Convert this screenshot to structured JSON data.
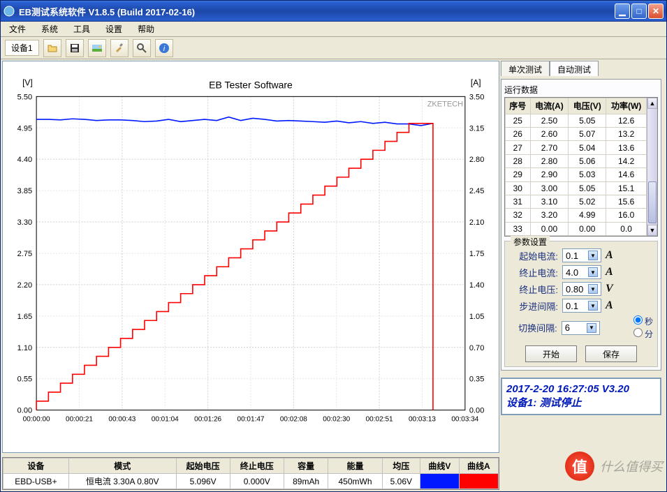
{
  "window": {
    "title": "EB测试系统软件  V1.8.5 (Build 2017-02-16)"
  },
  "menus": [
    "文件",
    "系统",
    "工具",
    "设置",
    "帮助"
  ],
  "toolbar": {
    "device_label": "设备1"
  },
  "chart_data": {
    "type": "line",
    "title": "EB Tester Software",
    "left_unit": "[V]",
    "right_unit": "[A]",
    "watermark": "ZKETECH",
    "x_ticks": [
      "00:00:00",
      "00:00:21",
      "00:00:43",
      "00:01:04",
      "00:01:26",
      "00:01:47",
      "00:02:08",
      "00:02:30",
      "00:02:51",
      "00:03:13",
      "00:03:34"
    ],
    "v_ticks": [
      "5.50",
      "4.95",
      "4.40",
      "3.85",
      "3.30",
      "2.75",
      "2.20",
      "1.65",
      "1.10",
      "0.55",
      "0.00"
    ],
    "a_ticks": [
      "3.50",
      "3.15",
      "2.80",
      "2.45",
      "2.10",
      "1.75",
      "1.40",
      "1.05",
      "0.70",
      "0.35",
      "0.00"
    ],
    "v_range": [
      0,
      5.5
    ],
    "a_range": [
      0,
      3.5
    ],
    "x_range_sec": [
      0,
      214
    ],
    "series": [
      {
        "name": "曲线V",
        "axis": "V",
        "color": "#0018ff",
        "points": [
          [
            0,
            5.1
          ],
          [
            6,
            5.1
          ],
          [
            12,
            5.09
          ],
          [
            18,
            5.11
          ],
          [
            24,
            5.1
          ],
          [
            30,
            5.08
          ],
          [
            36,
            5.09
          ],
          [
            42,
            5.09
          ],
          [
            48,
            5.08
          ],
          [
            54,
            5.06
          ],
          [
            60,
            5.07
          ],
          [
            66,
            5.1
          ],
          [
            72,
            5.06
          ],
          [
            78,
            5.08
          ],
          [
            84,
            5.1
          ],
          [
            90,
            5.08
          ],
          [
            96,
            5.14
          ],
          [
            102,
            5.08
          ],
          [
            108,
            5.12
          ],
          [
            114,
            5.1
          ],
          [
            120,
            5.07
          ],
          [
            126,
            5.08
          ],
          [
            132,
            5.07
          ],
          [
            138,
            5.06
          ],
          [
            144,
            5.05
          ],
          [
            150,
            5.07
          ],
          [
            156,
            5.04
          ],
          [
            162,
            5.06
          ],
          [
            168,
            5.03
          ],
          [
            174,
            5.05
          ],
          [
            180,
            5.02
          ],
          [
            186,
            5.02
          ],
          [
            192,
            4.99
          ],
          [
            198,
            5.03
          ]
        ]
      },
      {
        "name": "曲线A",
        "axis": "A",
        "color": "#ff0000",
        "points": [
          [
            0,
            0.0
          ],
          [
            0,
            0.1
          ],
          [
            6,
            0.1
          ],
          [
            6,
            0.2
          ],
          [
            12,
            0.2
          ],
          [
            12,
            0.3
          ],
          [
            18,
            0.3
          ],
          [
            18,
            0.4
          ],
          [
            24,
            0.4
          ],
          [
            24,
            0.5
          ],
          [
            30,
            0.5
          ],
          [
            30,
            0.6
          ],
          [
            36,
            0.6
          ],
          [
            36,
            0.7
          ],
          [
            42,
            0.7
          ],
          [
            42,
            0.8
          ],
          [
            48,
            0.8
          ],
          [
            48,
            0.9
          ],
          [
            54,
            0.9
          ],
          [
            54,
            1.0
          ],
          [
            60,
            1.0
          ],
          [
            60,
            1.1
          ],
          [
            66,
            1.1
          ],
          [
            66,
            1.2
          ],
          [
            72,
            1.2
          ],
          [
            72,
            1.3
          ],
          [
            78,
            1.3
          ],
          [
            78,
            1.4
          ],
          [
            84,
            1.4
          ],
          [
            84,
            1.5
          ],
          [
            90,
            1.5
          ],
          [
            90,
            1.6
          ],
          [
            96,
            1.6
          ],
          [
            96,
            1.7
          ],
          [
            102,
            1.7
          ],
          [
            102,
            1.8
          ],
          [
            108,
            1.8
          ],
          [
            108,
            1.9
          ],
          [
            114,
            1.9
          ],
          [
            114,
            2.0
          ],
          [
            120,
            2.0
          ],
          [
            120,
            2.1
          ],
          [
            126,
            2.1
          ],
          [
            126,
            2.2
          ],
          [
            132,
            2.2
          ],
          [
            132,
            2.3
          ],
          [
            138,
            2.3
          ],
          [
            138,
            2.4
          ],
          [
            144,
            2.4
          ],
          [
            144,
            2.5
          ],
          [
            150,
            2.5
          ],
          [
            150,
            2.6
          ],
          [
            156,
            2.6
          ],
          [
            156,
            2.7
          ],
          [
            162,
            2.7
          ],
          [
            162,
            2.8
          ],
          [
            168,
            2.8
          ],
          [
            168,
            2.9
          ],
          [
            174,
            2.9
          ],
          [
            174,
            3.0
          ],
          [
            180,
            3.0
          ],
          [
            180,
            3.1
          ],
          [
            186,
            3.1
          ],
          [
            186,
            3.2
          ],
          [
            192,
            3.2
          ],
          [
            198,
            3.2
          ],
          [
            198,
            0.0
          ]
        ]
      }
    ]
  },
  "summary": {
    "headers": [
      "设备",
      "模式",
      "起始电压",
      "终止电压",
      "容量",
      "能量",
      "均压",
      "曲线V",
      "曲线A"
    ],
    "row": {
      "device": "EBD-USB+",
      "mode": "恒电流 3.30A 0.80V",
      "start_v": "5.096V",
      "end_v": "0.000V",
      "capacity": "89mAh",
      "energy": "450mWh",
      "avg_v": "5.06V"
    }
  },
  "tabs": {
    "single": "单次测试",
    "auto": "自动测试"
  },
  "run_data": {
    "label": "运行数据",
    "headers": [
      "序号",
      "电流(A)",
      "电压(V)",
      "功率(W)"
    ],
    "rows": [
      {
        "n": "25",
        "a": "2.50",
        "v": "5.05",
        "w": "12.6"
      },
      {
        "n": "26",
        "a": "2.60",
        "v": "5.07",
        "w": "13.2"
      },
      {
        "n": "27",
        "a": "2.70",
        "v": "5.04",
        "w": "13.6"
      },
      {
        "n": "28",
        "a": "2.80",
        "v": "5.06",
        "w": "14.2"
      },
      {
        "n": "29",
        "a": "2.90",
        "v": "5.03",
        "w": "14.6"
      },
      {
        "n": "30",
        "a": "3.00",
        "v": "5.05",
        "w": "15.1"
      },
      {
        "n": "31",
        "a": "3.10",
        "v": "5.02",
        "w": "15.6"
      },
      {
        "n": "32",
        "a": "3.20",
        "v": "4.99",
        "w": "16.0"
      },
      {
        "n": "33",
        "a": "0.00",
        "v": "0.00",
        "w": "0.0"
      }
    ]
  },
  "params": {
    "label": "参数设置",
    "start_i": {
      "label": "起始电流:",
      "value": "0.1",
      "unit": "A"
    },
    "end_i": {
      "label": "终止电流:",
      "value": "4.0",
      "unit": "A"
    },
    "end_v": {
      "label": "终止电压:",
      "value": "0.80",
      "unit": "V"
    },
    "step": {
      "label": "步进间隔:",
      "value": "0.1",
      "unit": "A"
    },
    "switch": {
      "label": "切换间隔:",
      "value": "6",
      "sec": "秒",
      "min": "分"
    },
    "start_btn": "开始",
    "save_btn": "保存"
  },
  "status": {
    "line1": "2017-2-20 16:27:05  V3.20",
    "line2": "设备1: 测试停止"
  },
  "brand": {
    "text": "什么值得买",
    "coin": "值"
  }
}
